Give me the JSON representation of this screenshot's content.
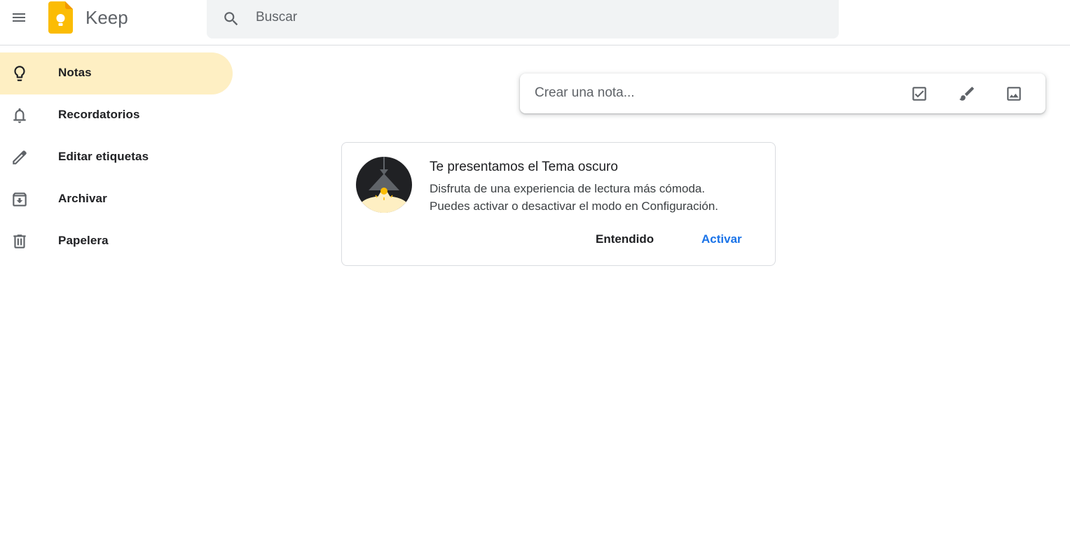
{
  "header": {
    "menu_icon": "menu-icon",
    "logo_icon": "keep-bulb-logo",
    "brand": "Keep",
    "search": {
      "icon": "search-icon",
      "placeholder": "Buscar",
      "value": ""
    }
  },
  "sidebar": {
    "items": [
      {
        "icon": "lightbulb-icon",
        "label": "Notas",
        "active": true
      },
      {
        "icon": "bell-icon",
        "label": "Recordatorios",
        "active": false
      },
      {
        "icon": "pencil-icon",
        "label": "Editar etiquetas",
        "active": false
      },
      {
        "icon": "archive-icon",
        "label": "Archivar",
        "active": false
      },
      {
        "icon": "trash-icon",
        "label": "Papelera",
        "active": false
      }
    ]
  },
  "take_note": {
    "placeholder": "Crear una nota...",
    "actions": [
      {
        "icon": "checkbox-icon"
      },
      {
        "icon": "brush-icon"
      },
      {
        "icon": "image-icon"
      }
    ]
  },
  "dark_theme_card": {
    "illustration": "lamp-illustration",
    "title": "Te presentamos el Tema oscuro",
    "body_line1": "Disfruta de una experiencia de lectura más cómoda.",
    "body_line2": "Puedes activar o desactivar el modo en Configuración.",
    "dismiss_label": "Entendido",
    "enable_label": "Activar"
  },
  "colors": {
    "active_nav": "#feefc3",
    "accent_blue": "#1a73e8",
    "logo_yellow": "#fbbc04",
    "search_bg": "#f1f3f4"
  }
}
